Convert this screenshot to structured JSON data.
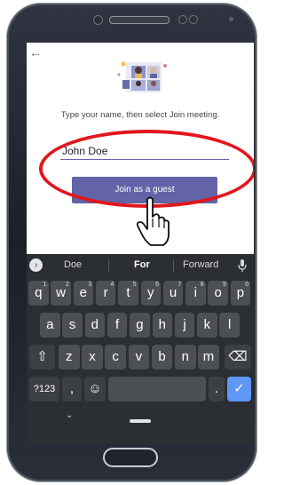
{
  "screen": {
    "hint_text": "Type your name, then select Join meeting.",
    "name_value": "John Doe",
    "join_label": "Join as a guest"
  },
  "suggestions": [
    "Doe",
    "For",
    "Forward"
  ],
  "keyboard": {
    "row1": [
      {
        "k": "q",
        "s": "1"
      },
      {
        "k": "w",
        "s": "2"
      },
      {
        "k": "e",
        "s": "3"
      },
      {
        "k": "r",
        "s": "4"
      },
      {
        "k": "t",
        "s": "5"
      },
      {
        "k": "y",
        "s": "6"
      },
      {
        "k": "u",
        "s": "7"
      },
      {
        "k": "i",
        "s": "8"
      },
      {
        "k": "o",
        "s": "9"
      },
      {
        "k": "p",
        "s": "0"
      }
    ],
    "row2": [
      "a",
      "s",
      "d",
      "f",
      "g",
      "h",
      "j",
      "k",
      "l"
    ],
    "row3": [
      "z",
      "x",
      "c",
      "v",
      "b",
      "n",
      "m"
    ],
    "symbols_label": "?123",
    "comma_label": ",",
    "period_label": ".",
    "emoji_label": "☺",
    "shift_label": "⇧",
    "delete_label": "⌫",
    "enter_label": "✓"
  },
  "colors": {
    "accent": "#6264a7",
    "highlight": "#e2161c",
    "keyboard_bg": "#2b2e33"
  }
}
